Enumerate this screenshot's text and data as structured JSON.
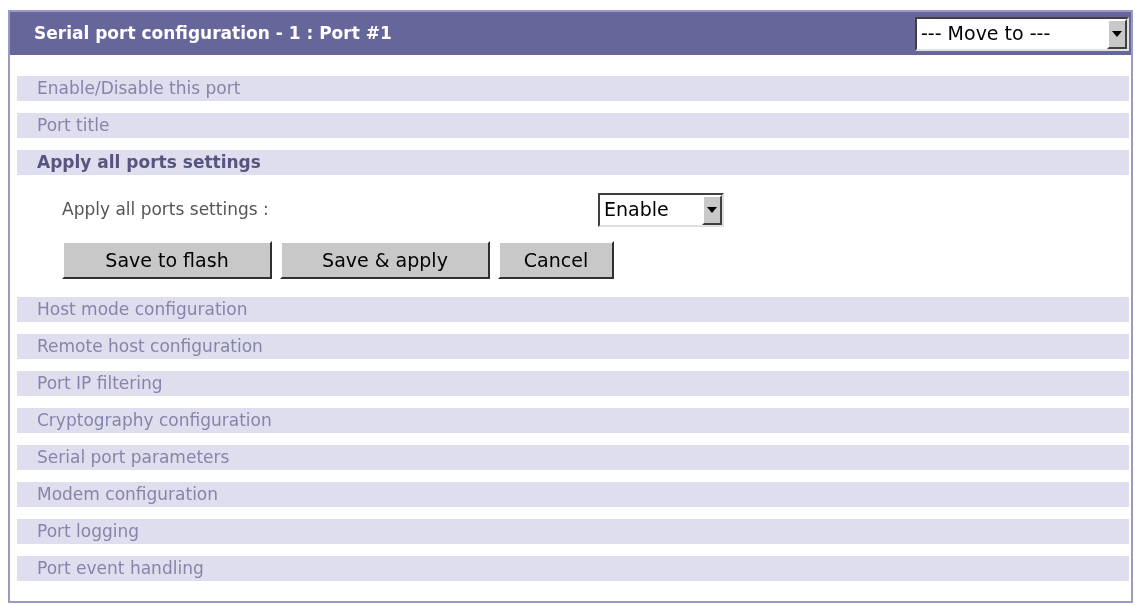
{
  "panel": {
    "title": "Serial port configuration - 1 : Port #1",
    "move_to": {
      "value": "--- Move to ---"
    }
  },
  "sections": [
    {
      "label": "Enable/Disable this port",
      "expanded": false
    },
    {
      "label": "Port title",
      "expanded": false
    },
    {
      "label": "Apply all ports settings",
      "expanded": true,
      "fields": [
        {
          "label": "Apply all ports settings :",
          "value": "Enable"
        }
      ],
      "buttons": [
        "Save to flash",
        "Save & apply",
        "Cancel"
      ]
    },
    {
      "label": "Host mode configuration",
      "expanded": false
    },
    {
      "label": "Remote host configuration",
      "expanded": false
    },
    {
      "label": "Port IP filtering",
      "expanded": false
    },
    {
      "label": "Cryptography configuration",
      "expanded": false
    },
    {
      "label": "Serial port parameters",
      "expanded": false
    },
    {
      "label": "Modem configuration",
      "expanded": false
    },
    {
      "label": "Port logging",
      "expanded": false
    },
    {
      "label": "Port event handling",
      "expanded": false
    }
  ]
}
